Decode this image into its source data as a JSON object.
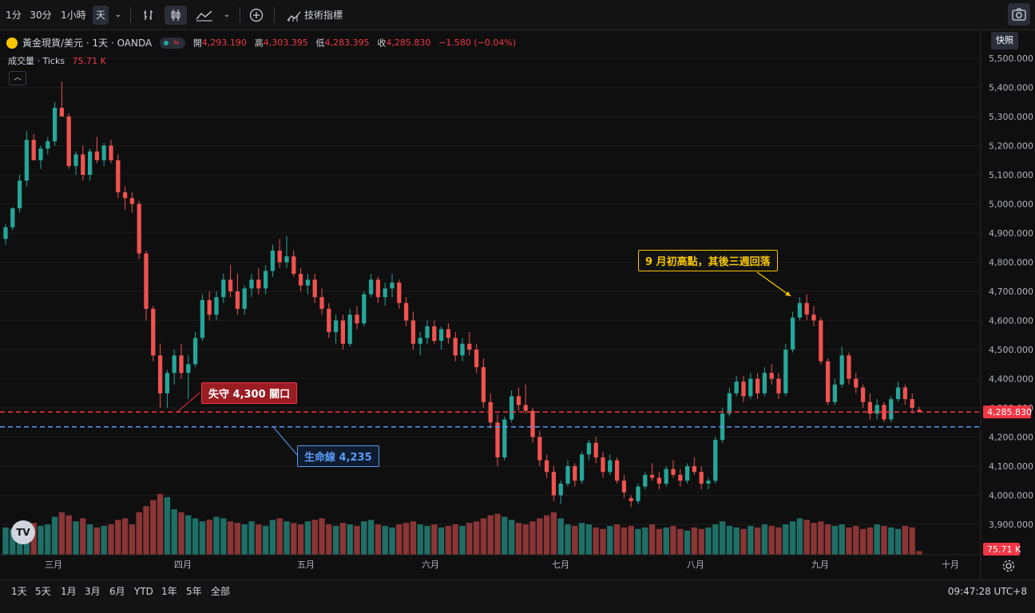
{
  "toolbar": {
    "intervals": [
      "1分",
      "30分",
      "1小時",
      "天"
    ],
    "active_interval": "天",
    "indicators_label": "技術指標"
  },
  "snapshot_tooltip": "快照",
  "legend": {
    "symbol": "黃金現貨/美元 · 1天 · OANDA",
    "open_label": "開",
    "open": "4,293.190",
    "high_label": "高",
    "high": "4,303.395",
    "low_label": "低",
    "low": "4,283.395",
    "close_label": "收",
    "close": "4,285.830",
    "change": "−1.580 (−0.04%)"
  },
  "volume_legend": {
    "label": "成交量 · Ticks",
    "value": "75.71 K"
  },
  "annotations": {
    "high_note": "9 月初高點，其後三週回落",
    "breakdown": "失守 4,300 關口",
    "lifeline": "生命線 4,235"
  },
  "price_axis": {
    "ticks": [
      "5,500.000",
      "5,400.000",
      "5,300.000",
      "5,200.000",
      "5,100.000",
      "5,000.000",
      "4,900.000",
      "4,800.000",
      "4,700.000",
      "4,600.000",
      "4,500.000",
      "4,400.000",
      "4,300.000",
      "4,200.000",
      "4,100.000",
      "4,000.000",
      "3,900.000"
    ],
    "last_price_badge": "4,285.830",
    "volume_badge": "75.71 K"
  },
  "time_axis": {
    "months": [
      "三月",
      "四月",
      "五月",
      "六月",
      "七月",
      "八月",
      "九月",
      "十月"
    ]
  },
  "bottom": {
    "ranges": [
      "1天",
      "5天",
      "1月",
      "3月",
      "6月",
      "YTD",
      "1年",
      "5年",
      "全部"
    ],
    "clock": "09:47:28 UTC+8"
  },
  "colors": {
    "up": "#26a69a",
    "down": "#ef5350",
    "red_line": "#f23645",
    "blue_line": "#5b9cf6",
    "yellow": "#f7c600"
  },
  "chart_data": {
    "type": "candlestick",
    "ylim": [
      3850,
      5520
    ],
    "support_levels": [
      4285.83,
      4235
    ],
    "candles": [
      [
        4880,
        4930,
        4860,
        4920
      ],
      [
        4920,
        4990,
        4910,
        4985
      ],
      [
        4985,
        5100,
        4970,
        5080
      ],
      [
        5080,
        5250,
        5060,
        5220
      ],
      [
        5220,
        5240,
        5150,
        5150
      ],
      [
        5150,
        5200,
        5120,
        5190
      ],
      [
        5190,
        5230,
        5170,
        5215
      ],
      [
        5215,
        5350,
        5200,
        5330
      ],
      [
        5330,
        5420,
        5300,
        5300
      ],
      [
        5300,
        5310,
        5120,
        5130
      ],
      [
        5130,
        5180,
        5100,
        5170
      ],
      [
        5170,
        5200,
        5080,
        5100
      ],
      [
        5100,
        5190,
        5080,
        5180
      ],
      [
        5180,
        5230,
        5140,
        5150
      ],
      [
        5150,
        5210,
        5130,
        5200
      ],
      [
        5200,
        5220,
        5140,
        5150
      ],
      [
        5150,
        5170,
        5020,
        5040
      ],
      [
        5040,
        5060,
        4980,
        5020
      ],
      [
        5020,
        5040,
        4970,
        5000
      ],
      [
        5000,
        5010,
        4810,
        4830
      ],
      [
        4830,
        4840,
        4600,
        4640
      ],
      [
        4640,
        4650,
        4460,
        4480
      ],
      [
        4480,
        4520,
        4300,
        4350
      ],
      [
        4350,
        4430,
        4300,
        4420
      ],
      [
        4420,
        4500,
        4380,
        4480
      ],
      [
        4480,
        4520,
        4400,
        4420
      ],
      [
        4420,
        4480,
        4330,
        4450
      ],
      [
        4450,
        4560,
        4440,
        4540
      ],
      [
        4540,
        4690,
        4530,
        4670
      ],
      [
        4670,
        4700,
        4600,
        4620
      ],
      [
        4620,
        4700,
        4600,
        4680
      ],
      [
        4680,
        4760,
        4660,
        4740
      ],
      [
        4740,
        4790,
        4680,
        4700
      ],
      [
        4700,
        4760,
        4620,
        4640
      ],
      [
        4640,
        4720,
        4620,
        4710
      ],
      [
        4710,
        4760,
        4680,
        4740
      ],
      [
        4740,
        4780,
        4690,
        4710
      ],
      [
        4710,
        4790,
        4690,
        4770
      ],
      [
        4770,
        4860,
        4750,
        4840
      ],
      [
        4840,
        4880,
        4780,
        4800
      ],
      [
        4800,
        4890,
        4780,
        4820
      ],
      [
        4820,
        4840,
        4750,
        4760
      ],
      [
        4760,
        4780,
        4700,
        4720
      ],
      [
        4720,
        4760,
        4690,
        4740
      ],
      [
        4740,
        4760,
        4660,
        4680
      ],
      [
        4680,
        4710,
        4620,
        4640
      ],
      [
        4640,
        4660,
        4540,
        4560
      ],
      [
        4560,
        4620,
        4520,
        4600
      ],
      [
        4600,
        4620,
        4500,
        4520
      ],
      [
        4520,
        4640,
        4510,
        4620
      ],
      [
        4620,
        4650,
        4570,
        4590
      ],
      [
        4590,
        4700,
        4580,
        4690
      ],
      [
        4690,
        4760,
        4680,
        4740
      ],
      [
        4740,
        4750,
        4660,
        4680
      ],
      [
        4680,
        4730,
        4650,
        4710
      ],
      [
        4710,
        4760,
        4680,
        4730
      ],
      [
        4730,
        4740,
        4640,
        4660
      ],
      [
        4660,
        4680,
        4580,
        4600
      ],
      [
        4600,
        4630,
        4500,
        4520
      ],
      [
        4520,
        4560,
        4480,
        4540
      ],
      [
        4540,
        4600,
        4520,
        4580
      ],
      [
        4580,
        4600,
        4520,
        4530
      ],
      [
        4530,
        4580,
        4500,
        4570
      ],
      [
        4570,
        4590,
        4520,
        4540
      ],
      [
        4540,
        4560,
        4460,
        4480
      ],
      [
        4480,
        4540,
        4460,
        4520
      ],
      [
        4520,
        4560,
        4480,
        4500
      ],
      [
        4500,
        4520,
        4420,
        4440
      ],
      [
        4440,
        4470,
        4300,
        4320
      ],
      [
        4320,
        4350,
        4230,
        4250
      ],
      [
        4250,
        4280,
        4100,
        4130
      ],
      [
        4130,
        4270,
        4120,
        4260
      ],
      [
        4260,
        4360,
        4250,
        4340
      ],
      [
        4340,
        4370,
        4290,
        4310
      ],
      [
        4310,
        4380,
        4280,
        4290
      ],
      [
        4290,
        4300,
        4180,
        4200
      ],
      [
        4200,
        4220,
        4100,
        4120
      ],
      [
        4120,
        4140,
        4060,
        4080
      ],
      [
        4080,
        4100,
        3980,
        4000
      ],
      [
        4000,
        4050,
        3970,
        4040
      ],
      [
        4040,
        4120,
        4030,
        4100
      ],
      [
        4100,
        4110,
        4030,
        4050
      ],
      [
        4050,
        4150,
        4040,
        4140
      ],
      [
        4140,
        4190,
        4120,
        4180
      ],
      [
        4180,
        4200,
        4110,
        4130
      ],
      [
        4130,
        4150,
        4060,
        4080
      ],
      [
        4080,
        4140,
        4070,
        4120
      ],
      [
        4120,
        4130,
        4040,
        4050
      ],
      [
        4050,
        4070,
        3990,
        4010
      ],
      [
        3990,
        4000,
        3960,
        3980
      ],
      [
        3980,
        4040,
        3970,
        4030
      ],
      [
        4030,
        4080,
        4020,
        4070
      ],
      [
        4070,
        4110,
        4050,
        4060
      ],
      [
        4060,
        4080,
        4020,
        4040
      ],
      [
        4040,
        4100,
        4030,
        4090
      ],
      [
        4090,
        4120,
        4060,
        4070
      ],
      [
        4070,
        4090,
        4030,
        4050
      ],
      [
        4050,
        4110,
        4040,
        4100
      ],
      [
        4100,
        4130,
        4070,
        4080
      ],
      [
        4080,
        4100,
        4020,
        4040
      ],
      [
        4040,
        4060,
        4020,
        4050
      ],
      [
        4050,
        4200,
        4040,
        4190
      ],
      [
        4190,
        4300,
        4180,
        4280
      ],
      [
        4280,
        4370,
        4270,
        4350
      ],
      [
        4350,
        4410,
        4340,
        4390
      ],
      [
        4390,
        4410,
        4320,
        4340
      ],
      [
        4340,
        4420,
        4330,
        4400
      ],
      [
        4400,
        4420,
        4330,
        4350
      ],
      [
        4350,
        4440,
        4340,
        4420
      ],
      [
        4420,
        4450,
        4380,
        4400
      ],
      [
        4400,
        4420,
        4330,
        4350
      ],
      [
        4350,
        4520,
        4340,
        4500
      ],
      [
        4500,
        4630,
        4490,
        4610
      ],
      [
        4610,
        4680,
        4600,
        4660
      ],
      [
        4660,
        4690,
        4600,
        4620
      ],
      [
        4620,
        4650,
        4580,
        4600
      ],
      [
        4600,
        4610,
        4450,
        4460
      ],
      [
        4460,
        4470,
        4310,
        4320
      ],
      [
        4320,
        4400,
        4310,
        4380
      ],
      [
        4380,
        4510,
        4370,
        4480
      ],
      [
        4480,
        4490,
        4380,
        4400
      ],
      [
        4400,
        4420,
        4350,
        4370
      ],
      [
        4370,
        4380,
        4300,
        4320
      ],
      [
        4320,
        4350,
        4260,
        4280
      ],
      [
        4280,
        4330,
        4260,
        4310
      ],
      [
        4310,
        4320,
        4250,
        4260
      ],
      [
        4260,
        4340,
        4250,
        4330
      ],
      [
        4330,
        4390,
        4320,
        4370
      ],
      [
        4370,
        4380,
        4310,
        4330
      ],
      [
        4330,
        4350,
        4280,
        4300
      ],
      [
        4293.19,
        4303.395,
        4283.395,
        4285.83
      ]
    ],
    "volumes": [
      0.9,
      0.85,
      1.0,
      1.1,
      1.05,
      0.95,
      1.0,
      1.25,
      1.4,
      1.3,
      1.1,
      1.2,
      1.0,
      0.9,
      0.95,
      1.0,
      1.15,
      1.2,
      1.0,
      1.4,
      1.6,
      1.8,
      2.0,
      1.9,
      1.5,
      1.4,
      1.3,
      1.2,
      1.1,
      1.15,
      1.25,
      1.2,
      1.1,
      1.05,
      1.0,
      1.1,
      1.0,
      0.95,
      1.15,
      1.2,
      1.1,
      1.05,
      1.0,
      1.1,
      1.15,
      1.2,
      1.0,
      0.95,
      1.05,
      1.0,
      0.95,
      1.1,
      1.15,
      1.0,
      0.95,
      0.9,
      1.0,
      1.05,
      1.1,
      1.0,
      0.95,
      1.0,
      0.9,
      0.95,
      1.0,
      0.95,
      1.05,
      1.1,
      1.2,
      1.3,
      1.35,
      1.25,
      1.15,
      1.05,
      1.0,
      1.1,
      1.2,
      1.3,
      1.4,
      1.2,
      1.0,
      0.95,
      1.05,
      1.0,
      0.9,
      0.85,
      0.95,
      1.0,
      0.9,
      0.95,
      0.85,
      0.9,
      1.0,
      0.85,
      0.9,
      0.95,
      0.85,
      0.8,
      0.9,
      0.85,
      0.9,
      1.0,
      1.1,
      0.95,
      0.9,
      0.85,
      0.95,
      0.9,
      1.0,
      0.95,
      0.9,
      1.0,
      1.1,
      1.2,
      1.15,
      1.05,
      1.1,
      1.0,
      0.95,
      1.0,
      0.9,
      0.95,
      0.85,
      0.9,
      1.0,
      0.95,
      0.9,
      0.85,
      0.95,
      0.9,
      0.12
    ]
  }
}
